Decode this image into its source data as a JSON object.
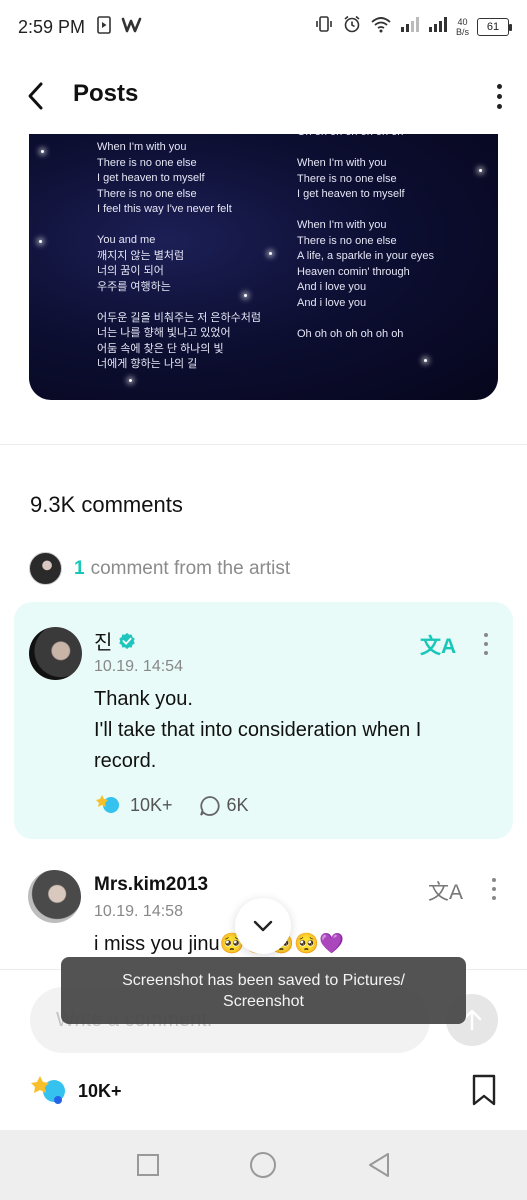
{
  "status_bar": {
    "time": "2:59 PM",
    "net_speed_value": "40",
    "net_speed_unit": "B/s",
    "battery": "61",
    "icons": [
      "screen-record-icon",
      "w-app-icon",
      "vibrate-icon",
      "alarm-icon",
      "wifi-icon",
      "signal-icon",
      "signal-icon"
    ]
  },
  "header": {
    "title": "Posts",
    "back_icon": "chevron-left-icon",
    "more_icon": "more-vertical-icon"
  },
  "post_image": {
    "lyrics_left": "When I'm with you\nThere is no one else\nI get heaven to myself\nThere is no one else\nI feel this way I've never felt\n\nYou and me\n깨지지 않는 별처럼\n너의 꿈이 되어\n우주를 여행하는\n\n어두운 길을 비춰주는 저 은하수처럼\n너는 나를 향해 빛나고 있었어\n어둠 속에 찾은 단 하나의 빛\n너에게 향하는 나의 길",
    "lyrics_right": "Oh oh oh oh oh oh oh\n\nWhen I'm with you\nThere is no one else\nI get heaven to myself\n\nWhen I'm with you\nThere is no one else\nA life, a sparkle in your eyes\nHeaven comin' through\nAnd i love you\nAnd i love you\n\nOh oh oh oh oh oh oh"
  },
  "comments": {
    "count_label": "9.3K comments",
    "artist_count": "1",
    "artist_label": "comment from the artist"
  },
  "artist_comment": {
    "author": "진",
    "date": "10.19. 14:54",
    "text_line1": "Thank you.",
    "text_line2": "I'll take that into consideration when I",
    "text_line3": "record.",
    "likes": "10K+",
    "replies": "6K",
    "translate_glyph": "文A"
  },
  "user_comment": {
    "author": "Mrs.kim2013",
    "date": "10.19. 14:58",
    "text": "i miss you jinu🥺🥺🥺🥺💜",
    "translate_glyph": "文A"
  },
  "input": {
    "placeholder": "Write a comment."
  },
  "toast": {
    "message": "Screenshot has been saved to  Pictures/ Screenshot"
  },
  "footer": {
    "likes": "10K+"
  },
  "colors": {
    "accent": "#19c7b8",
    "card_bg": "#e8fbf8",
    "verified": "#1fc6bd"
  }
}
